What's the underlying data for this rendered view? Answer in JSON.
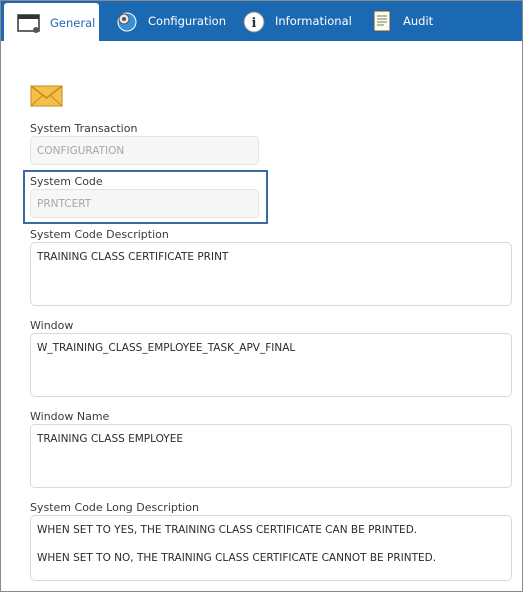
{
  "tabs": [
    {
      "label": "General",
      "icon": "window-icon",
      "active": true
    },
    {
      "label": "Configuration",
      "icon": "gear-globe-icon",
      "active": false
    },
    {
      "label": "Informational",
      "icon": "info-icon",
      "active": false
    },
    {
      "label": "Audit",
      "icon": "document-icon",
      "active": false
    }
  ],
  "header_icon": "envelope-icon",
  "fields": {
    "system_transaction": {
      "label": "System Transaction",
      "value": "CONFIGURATION"
    },
    "system_code": {
      "label": "System Code",
      "value": "PRNTCERT"
    },
    "system_code_description": {
      "label": "System Code Description",
      "value": "TRAINING CLASS CERTIFICATE PRINT"
    },
    "window": {
      "label": "Window",
      "value": "W_TRAINING_CLASS_EMPLOYEE_TASK_APV_FINAL"
    },
    "window_name": {
      "label": "Window Name",
      "value": "TRAINING CLASS EMPLOYEE"
    },
    "long_description": {
      "label": "System Code Long Description",
      "line1": "WHEN SET TO YES, THE TRAINING CLASS CERTIFICATE CAN BE PRINTED.",
      "line2": "WHEN SET TO NO, THE TRAINING CLASS CERTIFICATE CANNOT BE PRINTED."
    }
  },
  "colors": {
    "tabbar": "#1c69b3",
    "highlight": "#3b6aa3"
  }
}
